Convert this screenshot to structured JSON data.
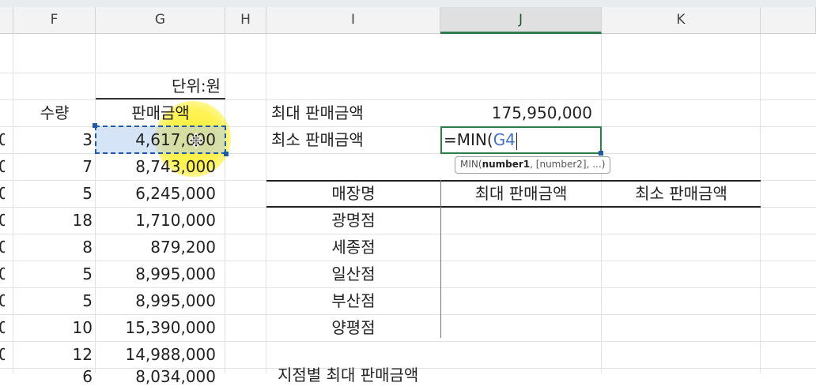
{
  "columns": [
    "F",
    "G",
    "H",
    "I",
    "J",
    "K"
  ],
  "selected_column": "J",
  "unit_label": "단위:원",
  "headers": {
    "quantity": "수량",
    "sales": "판매금액"
  },
  "rows": [
    {
      "qty": "3",
      "sales": "4,617,000"
    },
    {
      "qty": "7",
      "sales": "8,743,000"
    },
    {
      "qty": "5",
      "sales": "6,245,000"
    },
    {
      "qty": "18",
      "sales": "1,710,000"
    },
    {
      "qty": "8",
      "sales": "879,200"
    },
    {
      "qty": "5",
      "sales": "8,995,000"
    },
    {
      "qty": "5",
      "sales": "8,995,000"
    },
    {
      "qty": "10",
      "sales": "15,390,000"
    },
    {
      "qty": "12",
      "sales": "14,988,000"
    },
    {
      "qty": "6",
      "sales": "8,034,000"
    }
  ],
  "edge_digit": "0",
  "summary": {
    "max_label": "최대 판매금액",
    "max_value": "175,950,000",
    "min_label": "최소 판매금액",
    "formula_prefix": "=MIN(",
    "formula_ref": "G4"
  },
  "tooltip": {
    "fn": "MIN(",
    "arg1": "number1",
    "rest": ", [number2], ...)"
  },
  "store_table": {
    "headers": [
      "매장명",
      "최대 판매금액",
      "최소 판매금액"
    ],
    "stores": [
      "광명점",
      "세종점",
      "일산점",
      "부산점",
      "양평점"
    ]
  },
  "bottom_partial_label": "지점별 최대 판매금액"
}
